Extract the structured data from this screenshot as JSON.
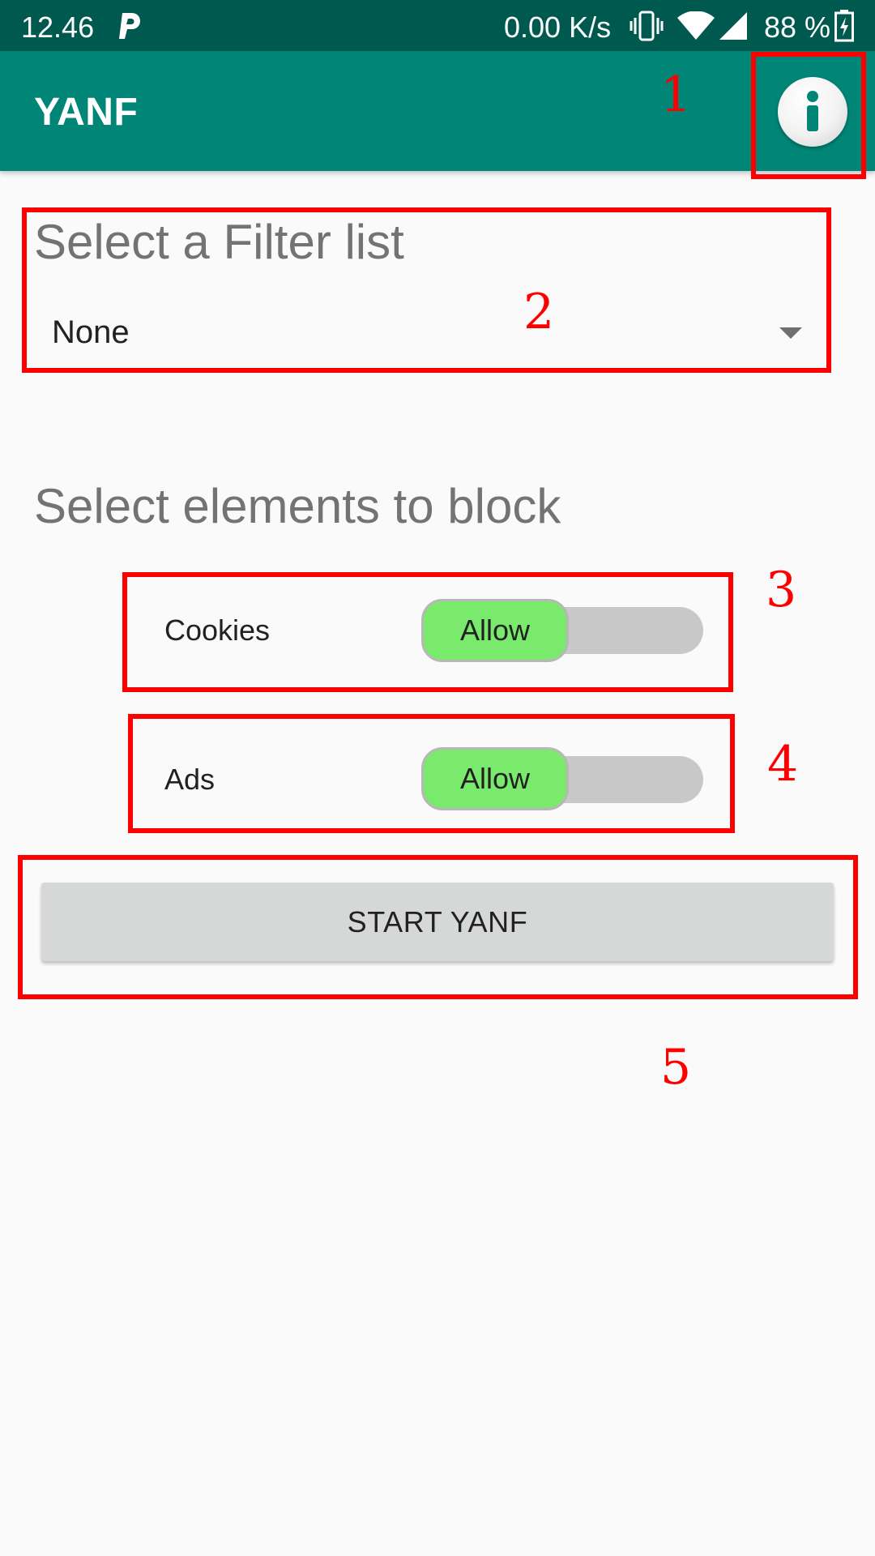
{
  "status_bar": {
    "time": "12.46",
    "network_speed": "0.00 K/s",
    "battery": "88 %",
    "icons": [
      "p-icon",
      "vibrate-icon",
      "wifi-icon",
      "signal-icon",
      "battery-charging-icon"
    ]
  },
  "app_bar": {
    "title": "YANF",
    "action_icon": "info-icon",
    "color": "#008577"
  },
  "filter_section": {
    "title": "Select a Filter list",
    "selected": "None"
  },
  "block_section": {
    "title": "Select elements to block",
    "rows": [
      {
        "label": "Cookies",
        "toggle_label": "Allow"
      },
      {
        "label": "Ads",
        "toggle_label": "Allow"
      }
    ]
  },
  "start_button": {
    "label": "START YANF"
  },
  "annotations": [
    "1",
    "2",
    "3",
    "4",
    "5"
  ],
  "colors": {
    "status_bar": "#00594f",
    "toggle_on": "#7aea6d",
    "annotation": "#ff0000"
  }
}
